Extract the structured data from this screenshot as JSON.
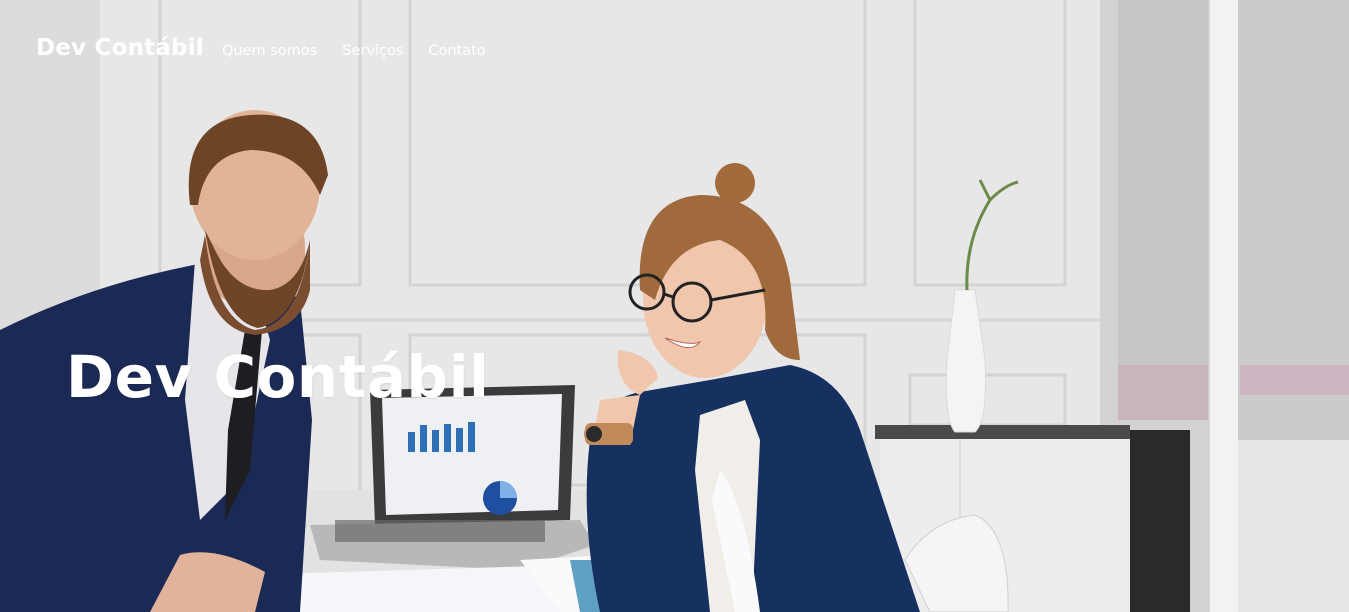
{
  "nav": {
    "brand": "Dev Contábil",
    "links": [
      {
        "label": "Quem somos"
      },
      {
        "label": "Serviços"
      },
      {
        "label": "Contato"
      }
    ]
  },
  "hero": {
    "title": "Dev Contábil",
    "image_subject": "business people at office desk with laptop"
  },
  "colors": {
    "nav_text": "#ffffff",
    "wall": "#e8e8e8",
    "suit_navy": "#16305f"
  }
}
